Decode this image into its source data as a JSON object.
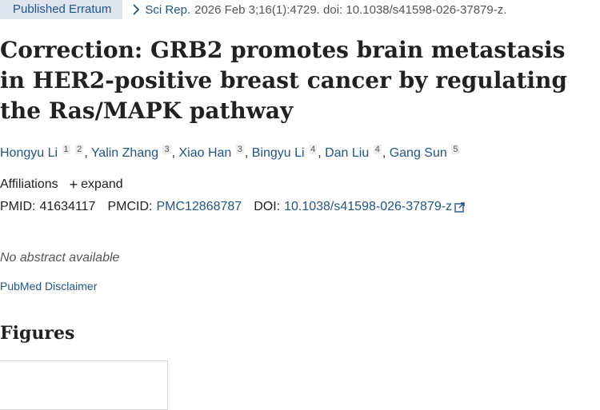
{
  "header": {
    "badge": "Published Erratum",
    "journal": "Sci Rep.",
    "citation": "2026 Feb 3;16(1):4729. doi: 10.1038/s41598-026-37879-z."
  },
  "title": "Correction: GRB2 promotes brain metastasis in HER2-positive breast cancer by regulating the Ras/MAPK pathway",
  "authors": [
    {
      "name": "Hongyu Li",
      "affs": [
        "1",
        "2"
      ]
    },
    {
      "name": "Yalin Zhang",
      "affs": [
        "3"
      ]
    },
    {
      "name": "Xiao Han",
      "affs": [
        "3"
      ]
    },
    {
      "name": "Bingyu Li",
      "affs": [
        "4"
      ]
    },
    {
      "name": "Dan Liu",
      "affs": [
        "4"
      ]
    },
    {
      "name": "Gang Sun",
      "affs": [
        "5"
      ]
    }
  ],
  "affiliations": {
    "label": "Affiliations",
    "expand": "expand"
  },
  "ids": {
    "pmid_label": "PMID:",
    "pmid": "41634117",
    "pmcid_label": "PMCID:",
    "pmcid": "PMC12868787",
    "doi_label": "DOI:",
    "doi": "10.1038/s41598-026-37879-z"
  },
  "abstract_note": "No abstract available",
  "disclaimer": "PubMed Disclaimer",
  "figures_heading": "Figures",
  "colors": {
    "link": "#20558a",
    "badge_bg": "#dfe4ef",
    "text": "#212121"
  }
}
